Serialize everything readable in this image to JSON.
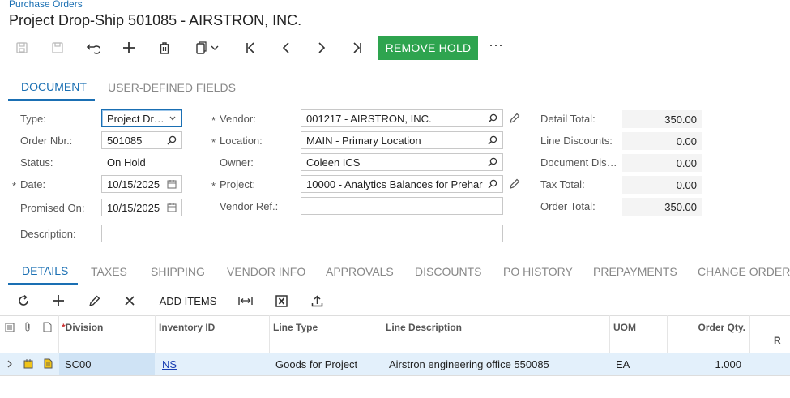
{
  "breadcrumb": "Purchase Orders",
  "page_title": "Project Drop-Ship 501085 - AIRSTRON, INC.",
  "toolbar": {
    "icons": [
      "save-close-icon",
      "save-icon",
      "undo-icon",
      "add-icon",
      "delete-icon",
      "copy-icon",
      "first-icon",
      "prev-icon",
      "next-icon",
      "last-icon"
    ],
    "action_label": "REMOVE HOLD",
    "more_label": "⋯"
  },
  "main_tabs": [
    {
      "label": "DOCUMENT",
      "active": true
    },
    {
      "label": "USER-DEFINED FIELDS",
      "active": false
    }
  ],
  "form": {
    "type_label": "Type:",
    "type_value": "Project Dr…",
    "order_nbr_label": "Order Nbr.:",
    "order_nbr_value": "501085",
    "status_label": "Status:",
    "status_value": "On Hold",
    "date_label": "Date:",
    "date_value": "10/15/2025",
    "promised_label": "Promised On:",
    "promised_value": "10/15/2025",
    "description_label": "Description:",
    "description_value": "",
    "vendor_label": "Vendor:",
    "vendor_value": "001217 - AIRSTRON, INC.",
    "location_label": "Location:",
    "location_value": "MAIN - Primary Location",
    "owner_label": "Owner:",
    "owner_value": "Coleen ICS",
    "project_label": "Project:",
    "project_value": "10000 - Analytics Balances for Prehar",
    "vendor_ref_label": "Vendor Ref.:",
    "vendor_ref_value": "",
    "required_mark": "*"
  },
  "totals": [
    {
      "label": "Detail Total:",
      "value": "350.00"
    },
    {
      "label": "Line Discounts:",
      "value": "0.00"
    },
    {
      "label": "Document Dis…",
      "value": "0.00"
    },
    {
      "label": "Tax Total:",
      "value": "0.00"
    },
    {
      "label": "Order Total:",
      "value": "350.00"
    }
  ],
  "detail_tabs": [
    {
      "label": "DETAILS",
      "active": true
    },
    {
      "label": "TAXES"
    },
    {
      "label": "SHIPPING"
    },
    {
      "label": "VENDOR INFO"
    },
    {
      "label": "APPROVALS"
    },
    {
      "label": "DISCOUNTS"
    },
    {
      "label": "PO HISTORY"
    },
    {
      "label": "PREPAYMENTS"
    },
    {
      "label": "CHANGE ORDERS"
    }
  ],
  "grid_toolbar": {
    "icons": [
      "refresh-icon",
      "add-row-icon",
      "edit-icon",
      "delete-row-icon",
      "fit-columns-icon",
      "export-excel-icon",
      "upload-icon"
    ],
    "add_items_label": "ADD ITEMS"
  },
  "grid": {
    "columns": [
      "Division",
      "Inventory ID",
      "Line Type",
      "Line Description",
      "UOM",
      "Order Qty."
    ],
    "division_required_mark": "*",
    "rows": [
      {
        "division": "SC00",
        "inventory_id": "NS",
        "line_type": "Goods for Project",
        "line_description": "Airstron engineering office 550085",
        "uom": "EA",
        "order_qty": "1.000"
      }
    ],
    "clipped_header": "R"
  },
  "colors": {
    "accent": "#1a6fb3",
    "action": "#2ea44f",
    "selected_row": "#e3f0fb"
  }
}
